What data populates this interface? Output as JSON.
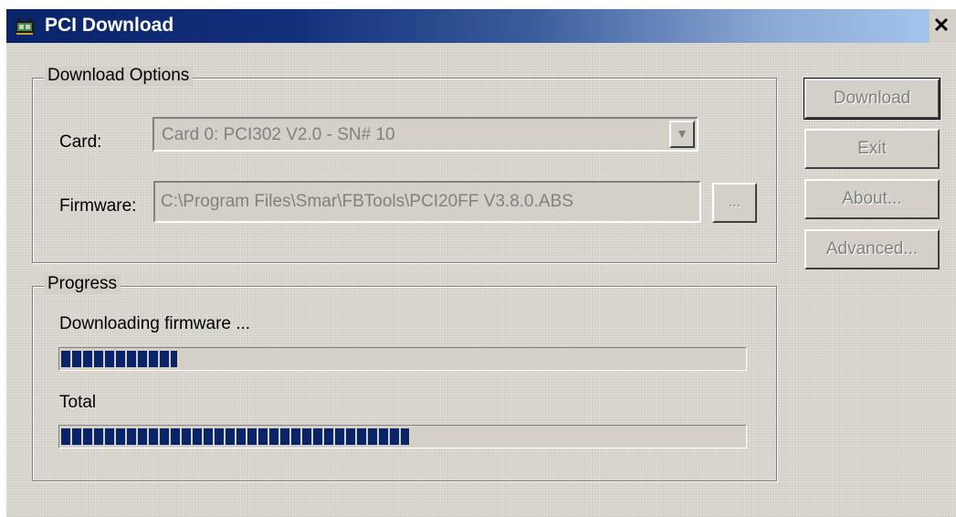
{
  "window": {
    "title": "PCI Download",
    "close_label": "✕"
  },
  "download_options": {
    "legend": "Download Options",
    "card_label": "Card:",
    "card_value": "Card 0:  PCI302 V2.0  -  SN# 10",
    "firmware_label": "Firmware:",
    "firmware_value": "C:\\Program Files\\Smar\\FBTools\\PCI20FF V3.8.0.ABS",
    "browse_label": "..."
  },
  "progress": {
    "legend": "Progress",
    "current_label": "Downloading firmware ...",
    "current_fraction": 0.17,
    "total_label": "Total",
    "total_fraction": 0.51
  },
  "buttons": {
    "download": "Download",
    "exit": "Exit",
    "about": "About...",
    "advanced": "Advanced..."
  },
  "colors": {
    "progress_fill": "#0a246a",
    "face": "#d4d0c8",
    "title_start": "#0a246a",
    "title_end": "#a6caf0"
  },
  "icons": {
    "app": "pci-card-icon",
    "combo_arrow": "chevron-down-icon"
  }
}
